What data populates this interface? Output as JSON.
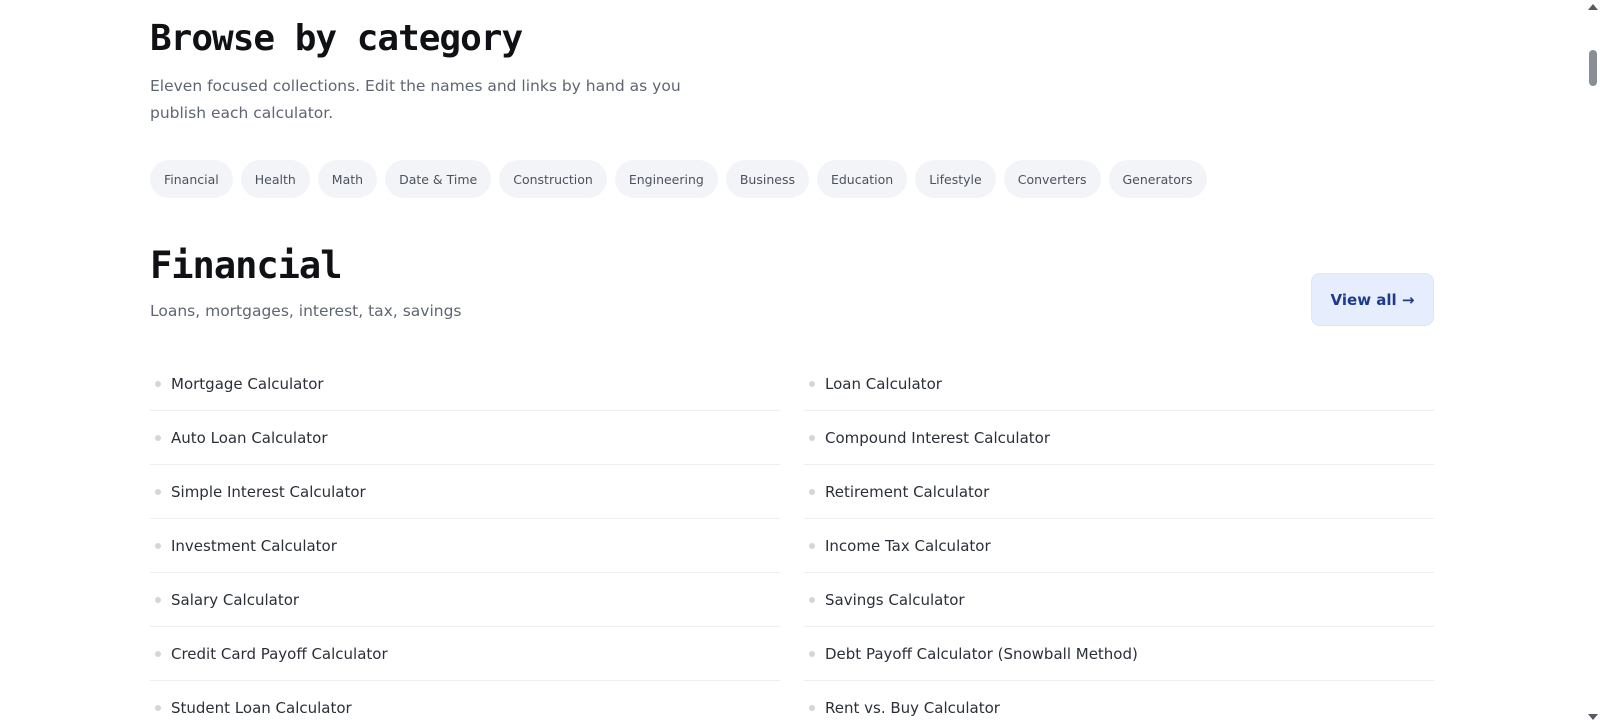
{
  "browse": {
    "title": "Browse by category",
    "subtitle": "Eleven focused collections. Edit the names and links by hand as you publish each calculator."
  },
  "categories": [
    {
      "label": "Financial"
    },
    {
      "label": "Health"
    },
    {
      "label": "Math"
    },
    {
      "label": "Date & Time"
    },
    {
      "label": "Construction"
    },
    {
      "label": "Engineering"
    },
    {
      "label": "Business"
    },
    {
      "label": "Education"
    },
    {
      "label": "Lifestyle"
    },
    {
      "label": "Converters"
    },
    {
      "label": "Generators"
    }
  ],
  "section": {
    "title": "Financial",
    "subtitle": "Loans, mortgages, interest, tax, savings",
    "view_all_label": "View all →"
  },
  "calculators_left": [
    {
      "label": "Mortgage Calculator"
    },
    {
      "label": "Auto Loan Calculator"
    },
    {
      "label": "Simple Interest Calculator"
    },
    {
      "label": "Investment Calculator"
    },
    {
      "label": "Salary Calculator"
    },
    {
      "label": "Credit Card Payoff Calculator"
    },
    {
      "label": "Student Loan Calculator"
    }
  ],
  "calculators_right": [
    {
      "label": "Loan Calculator"
    },
    {
      "label": "Compound Interest Calculator"
    },
    {
      "label": "Retirement Calculator"
    },
    {
      "label": "Income Tax Calculator"
    },
    {
      "label": "Savings Calculator"
    },
    {
      "label": "Debt Payoff Calculator (Snowball Method)"
    },
    {
      "label": "Rent vs. Buy Calculator"
    }
  ],
  "colors": {
    "accent_button_bg": "#e6edfc",
    "accent_button_text": "#1e3a8a",
    "chip_bg": "#f3f4f7"
  }
}
